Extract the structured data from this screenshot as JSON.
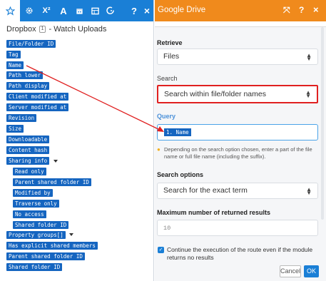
{
  "left_panel": {
    "toolbar": {
      "icons": [
        "star-icon",
        "gear-icon",
        "superscript-icon",
        "text-icon",
        "calendar-icon",
        "table-icon",
        "function-icon",
        "help-icon",
        "close-icon"
      ],
      "x2": "X²",
      "A": "A",
      "help": "?",
      "close": "×"
    },
    "breadcrumb": {
      "module": "Dropbox",
      "number": "1",
      "suffix": "- Watch Uploads"
    },
    "items": [
      "File/Folder ID",
      "Tag",
      "Name",
      "Path lower",
      "Path display",
      "Client modified at",
      "Server modified at",
      "Revision",
      "Size",
      "Downloadable",
      "Content hash",
      "Sharing info",
      "Read only",
      "Parent shared folder ID",
      "Modified by",
      "Traverse only",
      "No access",
      "Shared folder ID",
      "Property groups[]",
      "Has explicit shared members",
      "Parent shared folder ID",
      "Shared folder ID"
    ]
  },
  "right_panel": {
    "title": "Google Drive",
    "header_icons": {
      "expand": "⤧",
      "help": "?",
      "close": "×"
    },
    "retrieve": {
      "label": "Retrieve",
      "value": "Files"
    },
    "search": {
      "label": "Search",
      "value": "Search within file/folder names"
    },
    "query": {
      "label": "Query",
      "token": "1. Name",
      "hint": "Depending on the search option chosen, enter a part of the file name or full file name (including the suffix)."
    },
    "search_options": {
      "label": "Search options",
      "value": "Search for the exact term"
    },
    "max_results": {
      "label": "Maximum number of returned results",
      "value": "10"
    },
    "continue": {
      "text": "Continue the execution of the route even if the module returns no results"
    },
    "buttons": {
      "cancel": "Cancel",
      "ok": "OK"
    }
  },
  "colors": {
    "accent": "#1a7fd6",
    "header_orange": "#f08a1c",
    "pill_blue": "#1565c0",
    "highlight_red": "#e02020"
  }
}
